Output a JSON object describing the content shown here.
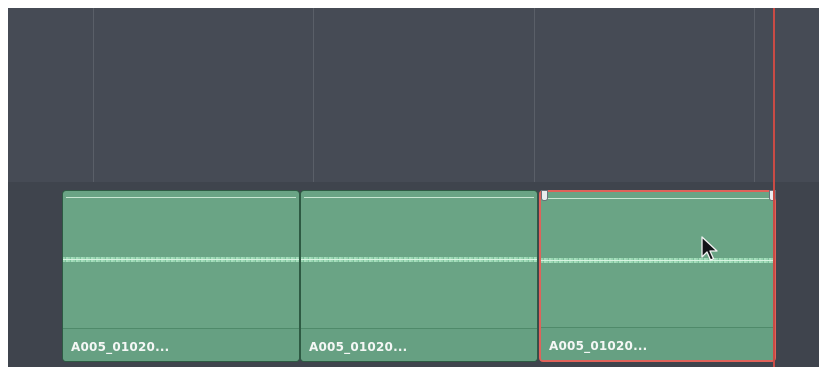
{
  "timeline": {
    "clips": [
      {
        "name": "A005_01020...",
        "selected": false
      },
      {
        "name": "A005_01020...",
        "selected": false
      },
      {
        "name": "A005_01020...",
        "selected": true
      }
    ],
    "icons": {
      "cursor": "mouse-pointer-icon",
      "trim_start": "trim-handle-left-icon",
      "trim_end": "trim-handle-right-icon"
    },
    "colors": {
      "background": "#464b55",
      "clip_fill": "#6aa485",
      "clip_selected_border": "#e0625a",
      "playhead": "#c94b45"
    }
  }
}
